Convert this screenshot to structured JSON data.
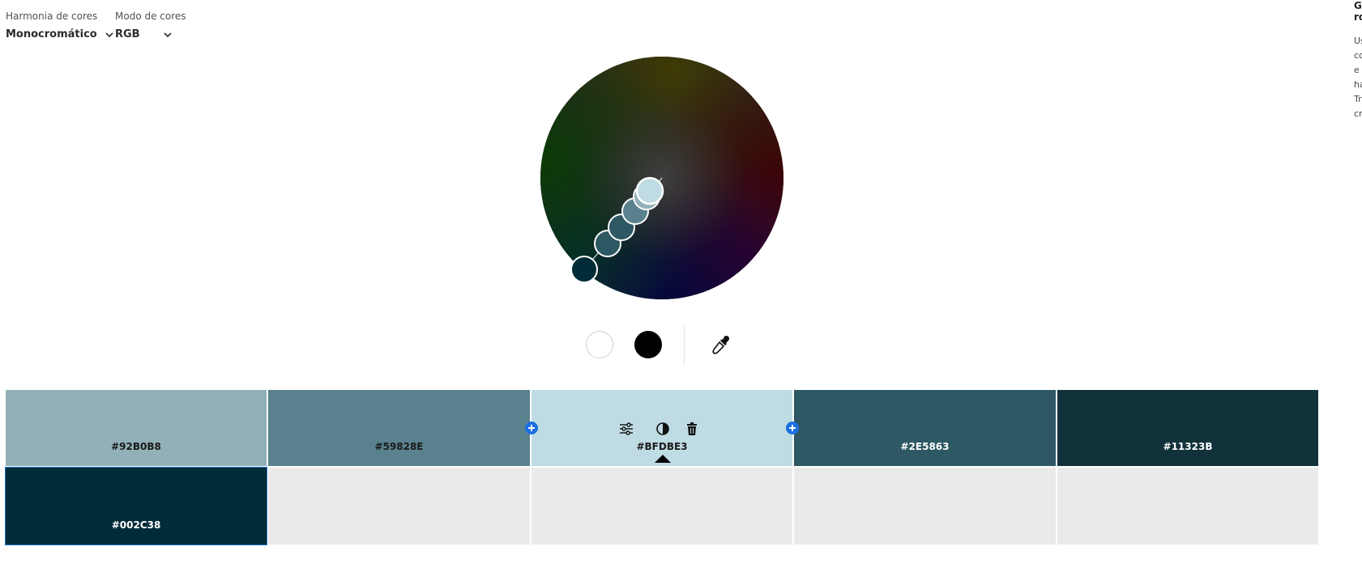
{
  "header": {
    "harmony_label": "Harmonia de cores",
    "harmony_value": "Monocromático",
    "mode_label": "Modo de cores",
    "mode_value": "RGB"
  },
  "controls": {
    "white_swatch_color": "#FFFFFF",
    "black_swatch_color": "#000000",
    "icons": [
      "eyedropper-icon",
      "sliders-icon",
      "contrast-icon",
      "trash-icon",
      "plus-icon",
      "chevron-down-icon"
    ]
  },
  "swatches": [
    {
      "hex": "#92B0B8",
      "color": "#92B0B8",
      "text_color": "#1a1a1a"
    },
    {
      "hex": "#59828E",
      "color": "#59828E",
      "text_color": "#1a1a1a"
    },
    {
      "hex": "#BFDBE3",
      "color": "#BFDBE3",
      "text_color": "#1a1a1a"
    },
    {
      "hex": "#2E5863",
      "color": "#2E5863",
      "text_color": "#ffffff"
    },
    {
      "hex": "#11323B",
      "color": "#11323B",
      "text_color": "#ffffff"
    },
    {
      "hex": "#002C38",
      "color": "#002C38",
      "text_color": "#ffffff"
    }
  ],
  "side_panel": {
    "title_fragments": [
      "G",
      "ro"
    ],
    "text_fragments": [
      "Us",
      "co",
      "e",
      "ha",
      "Tr",
      "cr"
    ]
  }
}
